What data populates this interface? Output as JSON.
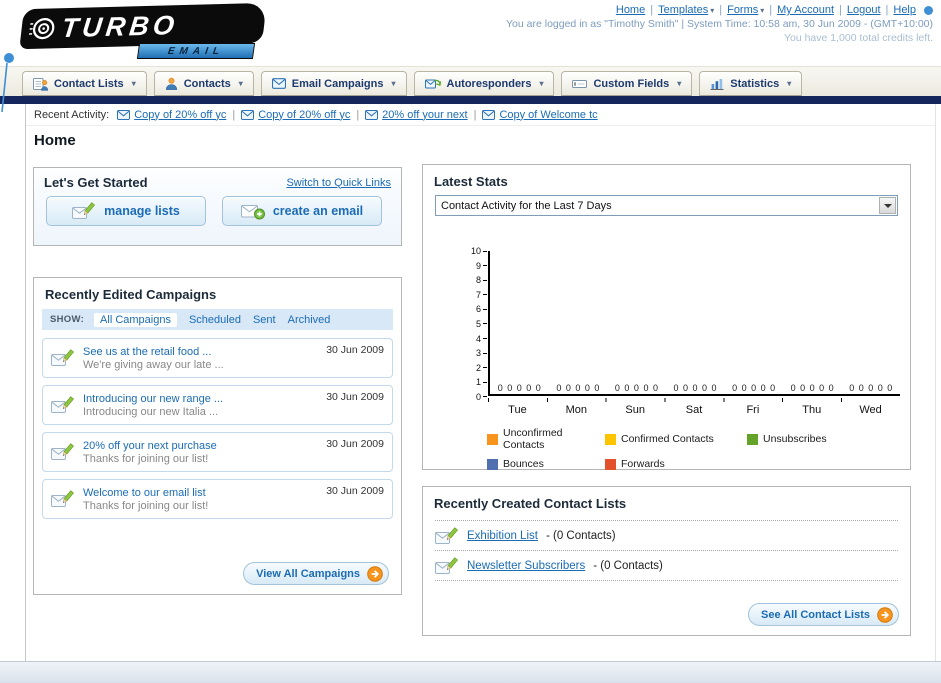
{
  "colors": {
    "link_blue": "#1b6cb5",
    "accent_orange": "#f7941d",
    "navy_bar": "#15265c"
  },
  "header": {
    "logo_text": "TURBO",
    "logo_sub": "EMAIL",
    "top_links": [
      {
        "label": "Home",
        "dropdown": false
      },
      {
        "label": "Templates",
        "dropdown": true
      },
      {
        "label": "Forms",
        "dropdown": true
      },
      {
        "label": "My Account",
        "dropdown": false
      },
      {
        "label": "Logout",
        "dropdown": false
      },
      {
        "label": "Help",
        "dropdown": false
      }
    ],
    "login_info": "You are logged in as \"Timothy Smith\" | System Time: 10:58 am, 30 Jun 2009 - (GMT+10:00)",
    "credits_info": "You have 1,000 total credits left."
  },
  "nav": {
    "tabs": [
      {
        "label": "Contact Lists",
        "icon": "contact-lists-icon"
      },
      {
        "label": "Contacts",
        "icon": "contacts-icon"
      },
      {
        "label": "Email Campaigns",
        "icon": "email-campaigns-icon"
      },
      {
        "label": "Autoresponders",
        "icon": "autoresponders-icon"
      },
      {
        "label": "Custom Fields",
        "icon": "custom-fields-icon"
      },
      {
        "label": "Statistics",
        "icon": "statistics-icon"
      }
    ]
  },
  "recent_activity": {
    "label": "Recent Activity:",
    "icon": "envelope-icon",
    "items": [
      "Copy of 20% off yc",
      "Copy of 20% off yc",
      "20% off your next",
      "Copy of Welcome tc"
    ]
  },
  "page": {
    "title": "Home"
  },
  "get_started": {
    "title": "Let's Get Started",
    "switch_link": "Switch to Quick Links",
    "manage_lists": "manage lists",
    "manage_icon": "envelope-pencil-icon",
    "create_email": "create an email",
    "create_icon": "envelope-plus-icon"
  },
  "campaigns": {
    "title": "Recently Edited Campaigns",
    "show_label": "SHOW:",
    "filters": [
      {
        "label": "All Campaigns",
        "selected": true
      },
      {
        "label": "Scheduled",
        "selected": false
      },
      {
        "label": "Sent",
        "selected": false
      },
      {
        "label": "Archived",
        "selected": false
      }
    ],
    "items": [
      {
        "title": "See us at the retail food ...",
        "subtitle": "We're giving away our late ...",
        "date": "30 Jun 2009"
      },
      {
        "title": "Introducing our new range ...",
        "subtitle": "Introducing our new Italia ...",
        "date": "30 Jun 2009"
      },
      {
        "title": "20% off your next purchase",
        "subtitle": "Thanks for joining our list!",
        "date": "30 Jun 2009"
      },
      {
        "title": "Welcome to our email list",
        "subtitle": "Thanks for joining our list!",
        "date": "30 Jun 2009"
      }
    ],
    "view_all": "View All Campaigns",
    "view_all_icon": "arrow-right-circle-icon"
  },
  "stats": {
    "title": "Latest Stats",
    "dropdown_value": "Contact Activity for the Last 7 Days",
    "legend": [
      {
        "label": "Unconfirmed Contacts",
        "color": "#f7941d"
      },
      {
        "label": "Confirmed Contacts",
        "color": "#fdc500"
      },
      {
        "label": "Unsubscribes",
        "color": "#64a327"
      },
      {
        "label": "Bounces",
        "color": "#4f6fae"
      },
      {
        "label": "Forwards",
        "color": "#e2502c"
      }
    ]
  },
  "chart_data": {
    "type": "bar",
    "title": "Contact Activity for the Last 7 Days",
    "categories": [
      "Tue",
      "Mon",
      "Sun",
      "Sat",
      "Fri",
      "Thu",
      "Wed"
    ],
    "series": [
      {
        "name": "Unconfirmed Contacts",
        "values": [
          0,
          0,
          0,
          0,
          0,
          0,
          0
        ]
      },
      {
        "name": "Confirmed Contacts",
        "values": [
          0,
          0,
          0,
          0,
          0,
          0,
          0
        ]
      },
      {
        "name": "Unsubscribes",
        "values": [
          0,
          0,
          0,
          0,
          0,
          0,
          0
        ]
      },
      {
        "name": "Bounces",
        "values": [
          0,
          0,
          0,
          0,
          0,
          0,
          0
        ]
      },
      {
        "name": "Forwards",
        "values": [
          0,
          0,
          0,
          0,
          0,
          0,
          0
        ]
      }
    ],
    "ylim": [
      0,
      10
    ],
    "yticks": [
      0,
      1,
      2,
      3,
      4,
      5,
      6,
      7,
      8,
      9,
      10
    ],
    "grid": false,
    "legend_position": "bottom"
  },
  "contact_lists": {
    "title": "Recently Created Contact Lists",
    "item_icon": "envelope-pencil-icon",
    "items": [
      {
        "name": "Exhibition List",
        "detail": "- (0 Contacts)"
      },
      {
        "name": "Newsletter Subscribers",
        "detail": "- (0 Contacts)"
      }
    ],
    "see_all": "See All Contact Lists",
    "see_all_icon": "arrow-right-circle-icon"
  }
}
